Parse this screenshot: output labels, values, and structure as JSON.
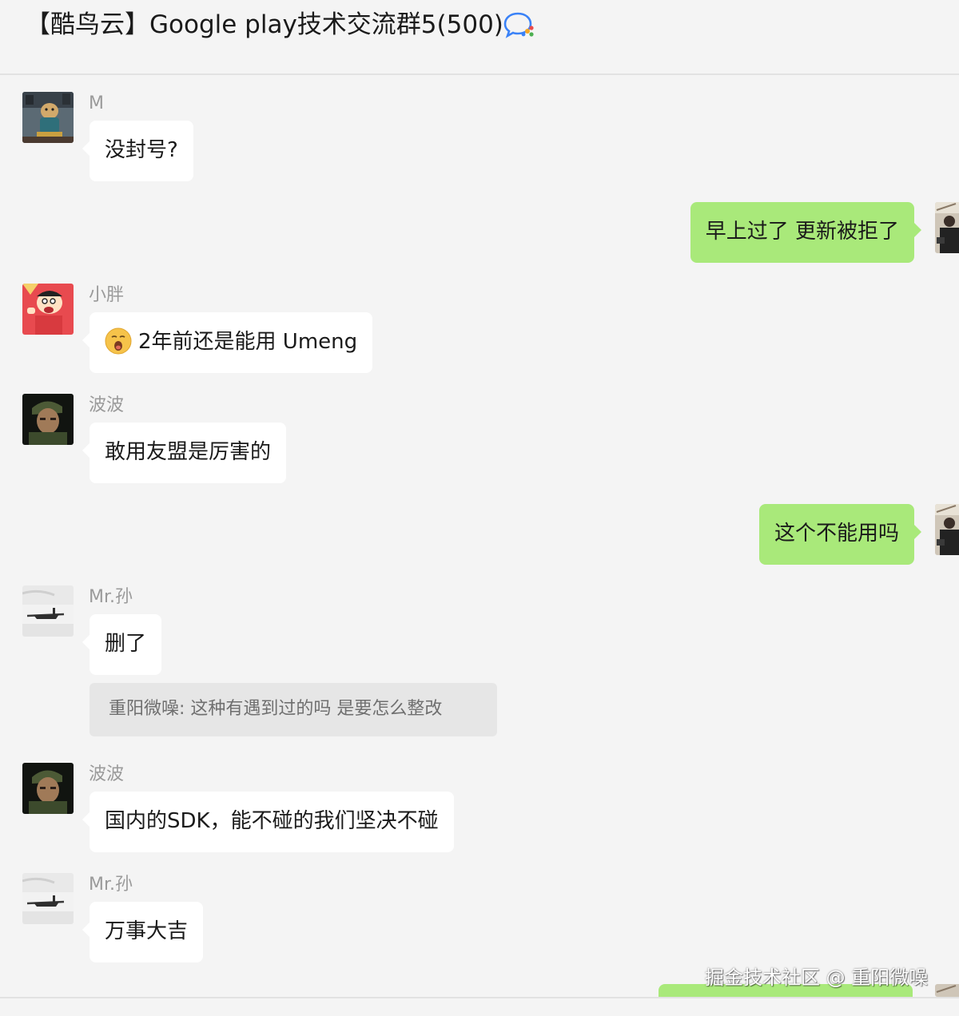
{
  "header": {
    "title": "【酷鸟云】Google play技术交流群5(500)",
    "icon": "chat-bubble-icon"
  },
  "messages": [
    {
      "sender": "M",
      "text": "没封号?",
      "direction": "incoming",
      "avatar": "dog-avatar"
    },
    {
      "text": "早上过了 更新被拒了",
      "direction": "outgoing",
      "avatar": "self-avatar"
    },
    {
      "sender": "小胖",
      "emoji": "yawn-emoji",
      "text": "2年前还是能用 Umeng",
      "direction": "incoming",
      "avatar": "cartoon-avatar"
    },
    {
      "sender": "波波",
      "text": "敢用友盟是厉害的",
      "direction": "incoming",
      "avatar": "soldier-avatar"
    },
    {
      "text": "这个不能用吗",
      "direction": "outgoing",
      "avatar": "self-avatar"
    },
    {
      "sender": "Mr.孙",
      "text": "删了",
      "direction": "incoming",
      "avatar": "boat-avatar",
      "quote": "重阳微噪: 这种有遇到过的吗 是要怎么整改"
    },
    {
      "sender": "波波",
      "text": "国内的SDK，能不碰的我们坚决不碰",
      "direction": "incoming",
      "avatar": "soldier-avatar"
    },
    {
      "sender": "Mr.孙",
      "text": "万事大吉",
      "direction": "incoming",
      "avatar": "boat-avatar"
    }
  ],
  "watermark": "掘金技术社区 @ 重阳微噪",
  "colors": {
    "background": "#f4f4f4",
    "incoming_bubble": "#ffffff",
    "outgoing_bubble": "#a9e97a",
    "sender_name": "#9a9a9a",
    "quote_background": "#e6e6e6"
  }
}
